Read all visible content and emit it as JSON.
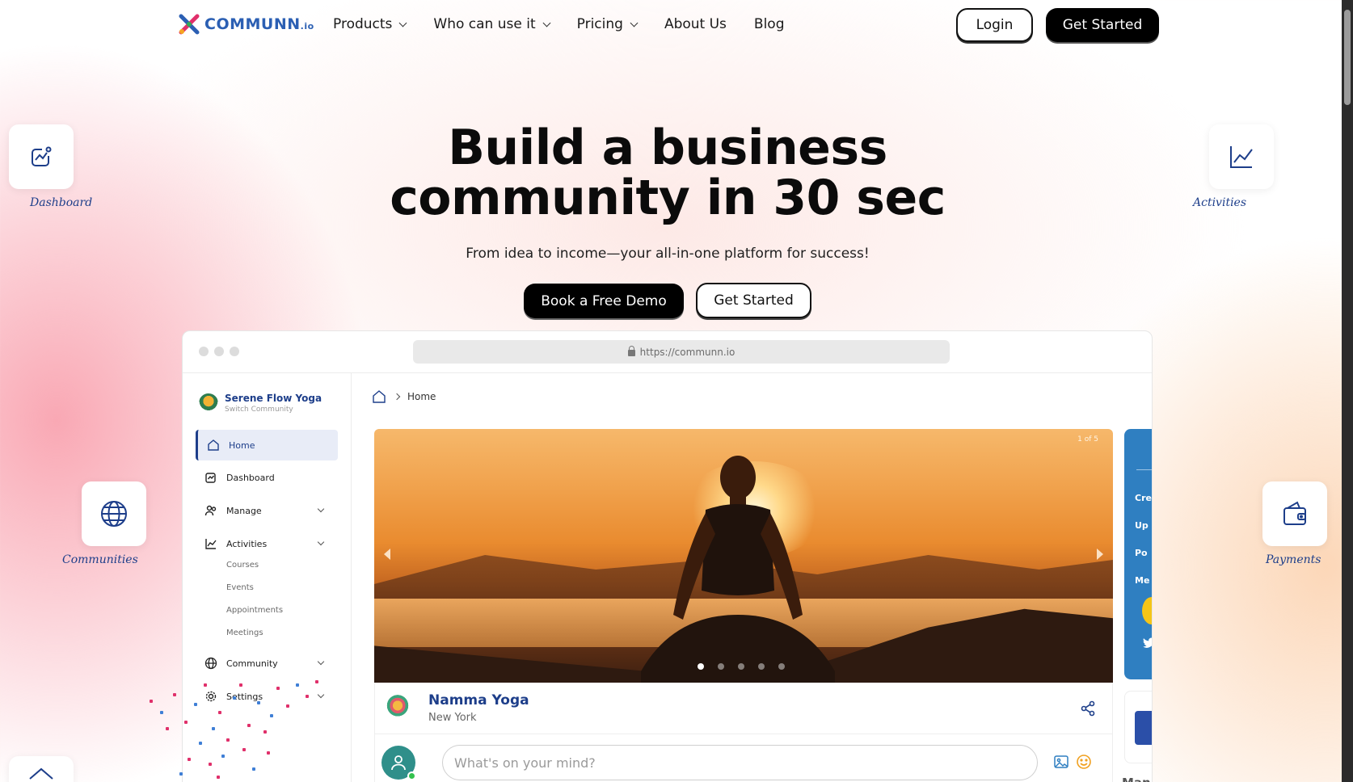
{
  "nav": {
    "logo_main": "COMMUNN",
    "logo_suffix": ".io",
    "links": [
      {
        "label": "Products",
        "has_dropdown": true
      },
      {
        "label": "Who can use it",
        "has_dropdown": true
      },
      {
        "label": "Pricing",
        "has_dropdown": true
      },
      {
        "label": "About Us",
        "has_dropdown": false
      },
      {
        "label": "Blog",
        "has_dropdown": false
      }
    ],
    "login_label": "Login",
    "get_started_label": "Get Started"
  },
  "hero": {
    "title_line1": "Build a business",
    "title_line2": "community in 30 sec",
    "subtitle": "From idea to income—your all-in-one platform for success!",
    "demo_button": "Book a Free Demo",
    "start_button": "Get Started"
  },
  "floating_cards": {
    "dashboard": {
      "label": "Dashboard",
      "icon": "dashboard-icon"
    },
    "activities": {
      "label": "Activities",
      "icon": "line-chart-icon"
    },
    "communities": {
      "label": "Communities",
      "icon": "globe-icon"
    },
    "payments": {
      "label": "Payments",
      "icon": "wallet-icon"
    }
  },
  "browser": {
    "url": "https://communn.io",
    "community": {
      "name": "Serene Flow Yoga",
      "switch_label": "Switch Community"
    },
    "sidebar": [
      {
        "label": "Home",
        "icon": "home-icon",
        "active": true
      },
      {
        "label": "Dashboard",
        "icon": "dashboard-icon"
      },
      {
        "label": "Manage",
        "icon": "users-icon",
        "expandable": true
      },
      {
        "label": "Activities",
        "icon": "line-chart-icon",
        "expandable": true
      },
      {
        "label": "Community",
        "icon": "globe-icon",
        "expandable": true
      },
      {
        "label": "Settings",
        "icon": "gear-icon",
        "expandable": true
      }
    ],
    "activities_sub": [
      "Courses",
      "Events",
      "Appointments",
      "Meetings"
    ],
    "breadcrumb": "Home",
    "banner": {
      "counter": "1 of 5",
      "slides": 5,
      "active_slide": 1
    },
    "profile": {
      "name": "Namma Yoga",
      "location": "New York"
    },
    "post_placeholder": "What's on your mind?",
    "right_panel_items": [
      "Cre",
      "Up",
      "Po",
      "Me"
    ],
    "right_panel_footer": "Man"
  },
  "colors": {
    "brand_blue": "#1d3e8a",
    "accent_black": "#000000",
    "panel_blue": "#2f7fc1"
  }
}
